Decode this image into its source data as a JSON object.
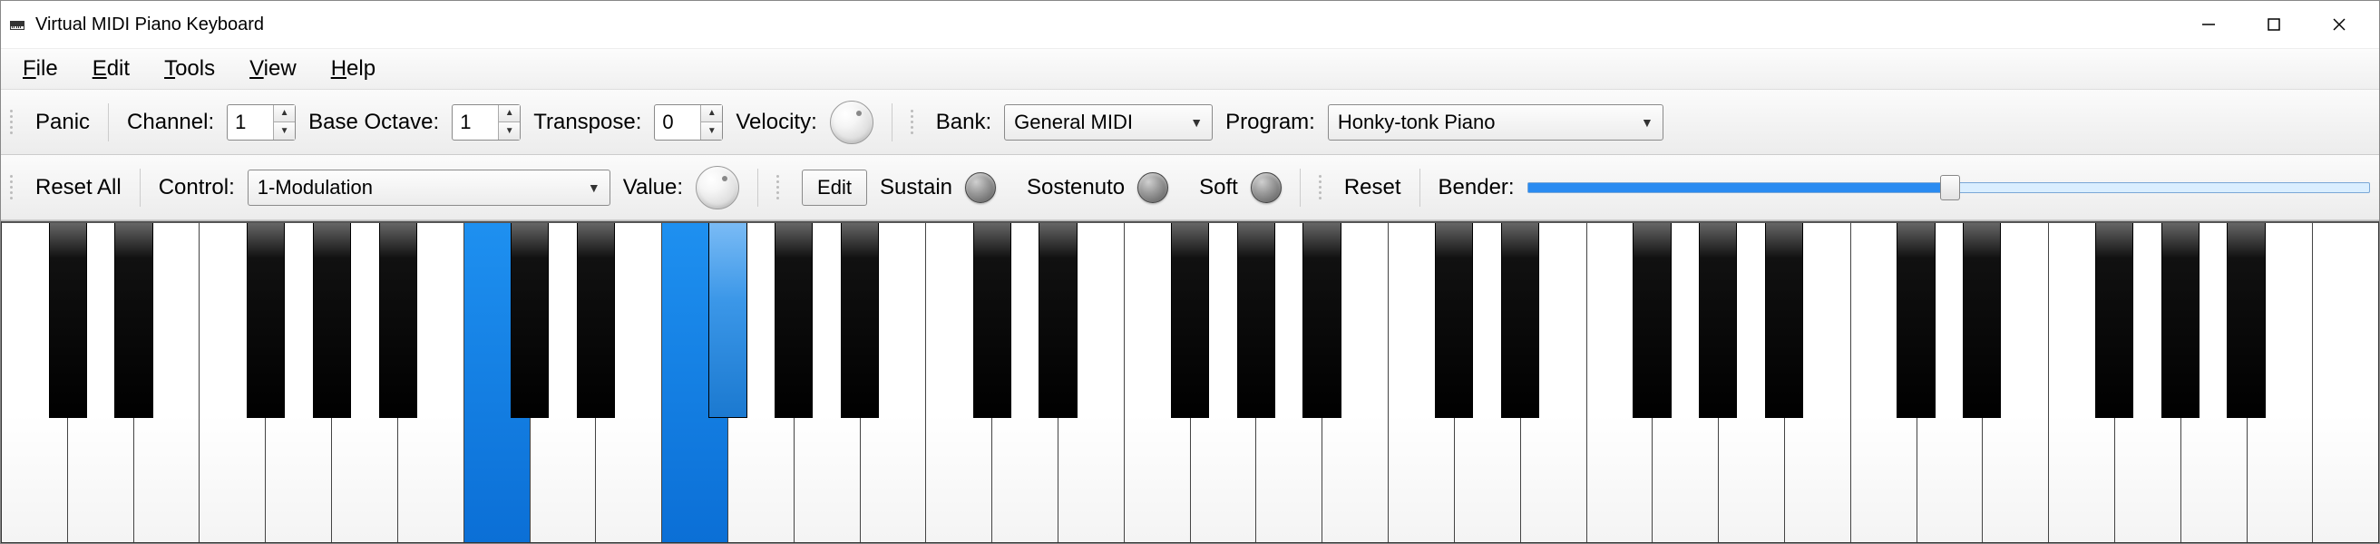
{
  "title": "Virtual MIDI Piano Keyboard",
  "menus": {
    "file": "File",
    "edit": "Edit",
    "tools": "Tools",
    "view": "View",
    "help": "Help"
  },
  "toolbar1": {
    "panic": "Panic",
    "channel_label": "Channel:",
    "channel_value": "1",
    "base_octave_label": "Base Octave:",
    "base_octave_value": "1",
    "transpose_label": "Transpose:",
    "transpose_value": "0",
    "velocity_label": "Velocity:",
    "bank_label": "Bank:",
    "bank_value": "General MIDI",
    "program_label": "Program:",
    "program_value": "Honky-tonk Piano"
  },
  "toolbar2": {
    "reset_all": "Reset All",
    "control_label": "Control:",
    "control_value": "1-Modulation",
    "value_label": "Value:",
    "edit": "Edit",
    "sustain": "Sustain",
    "sostenuto": "Sostenuto",
    "soft": "Soft",
    "reset": "Reset",
    "bender_label": "Bender:"
  },
  "piano": {
    "white_key_count": 36,
    "pressed_white_indices": [
      7,
      10
    ],
    "black_keys": [
      {
        "after_white": 0,
        "pressed": false
      },
      {
        "after_white": 1,
        "pressed": false
      },
      {
        "after_white": 3,
        "pressed": false
      },
      {
        "after_white": 4,
        "pressed": false
      },
      {
        "after_white": 5,
        "pressed": false
      },
      {
        "after_white": 7,
        "pressed": false
      },
      {
        "after_white": 8,
        "pressed": false
      },
      {
        "after_white": 10,
        "pressed": true
      },
      {
        "after_white": 11,
        "pressed": false
      },
      {
        "after_white": 12,
        "pressed": false
      },
      {
        "after_white": 14,
        "pressed": false
      },
      {
        "after_white": 15,
        "pressed": false
      },
      {
        "after_white": 17,
        "pressed": false
      },
      {
        "after_white": 18,
        "pressed": false
      },
      {
        "after_white": 19,
        "pressed": false
      },
      {
        "after_white": 21,
        "pressed": false
      },
      {
        "after_white": 22,
        "pressed": false
      },
      {
        "after_white": 24,
        "pressed": false
      },
      {
        "after_white": 25,
        "pressed": false
      },
      {
        "after_white": 26,
        "pressed": false
      },
      {
        "after_white": 28,
        "pressed": false
      },
      {
        "after_white": 29,
        "pressed": false
      },
      {
        "after_white": 31,
        "pressed": false
      },
      {
        "after_white": 32,
        "pressed": false
      },
      {
        "after_white": 33,
        "pressed": false
      }
    ]
  }
}
